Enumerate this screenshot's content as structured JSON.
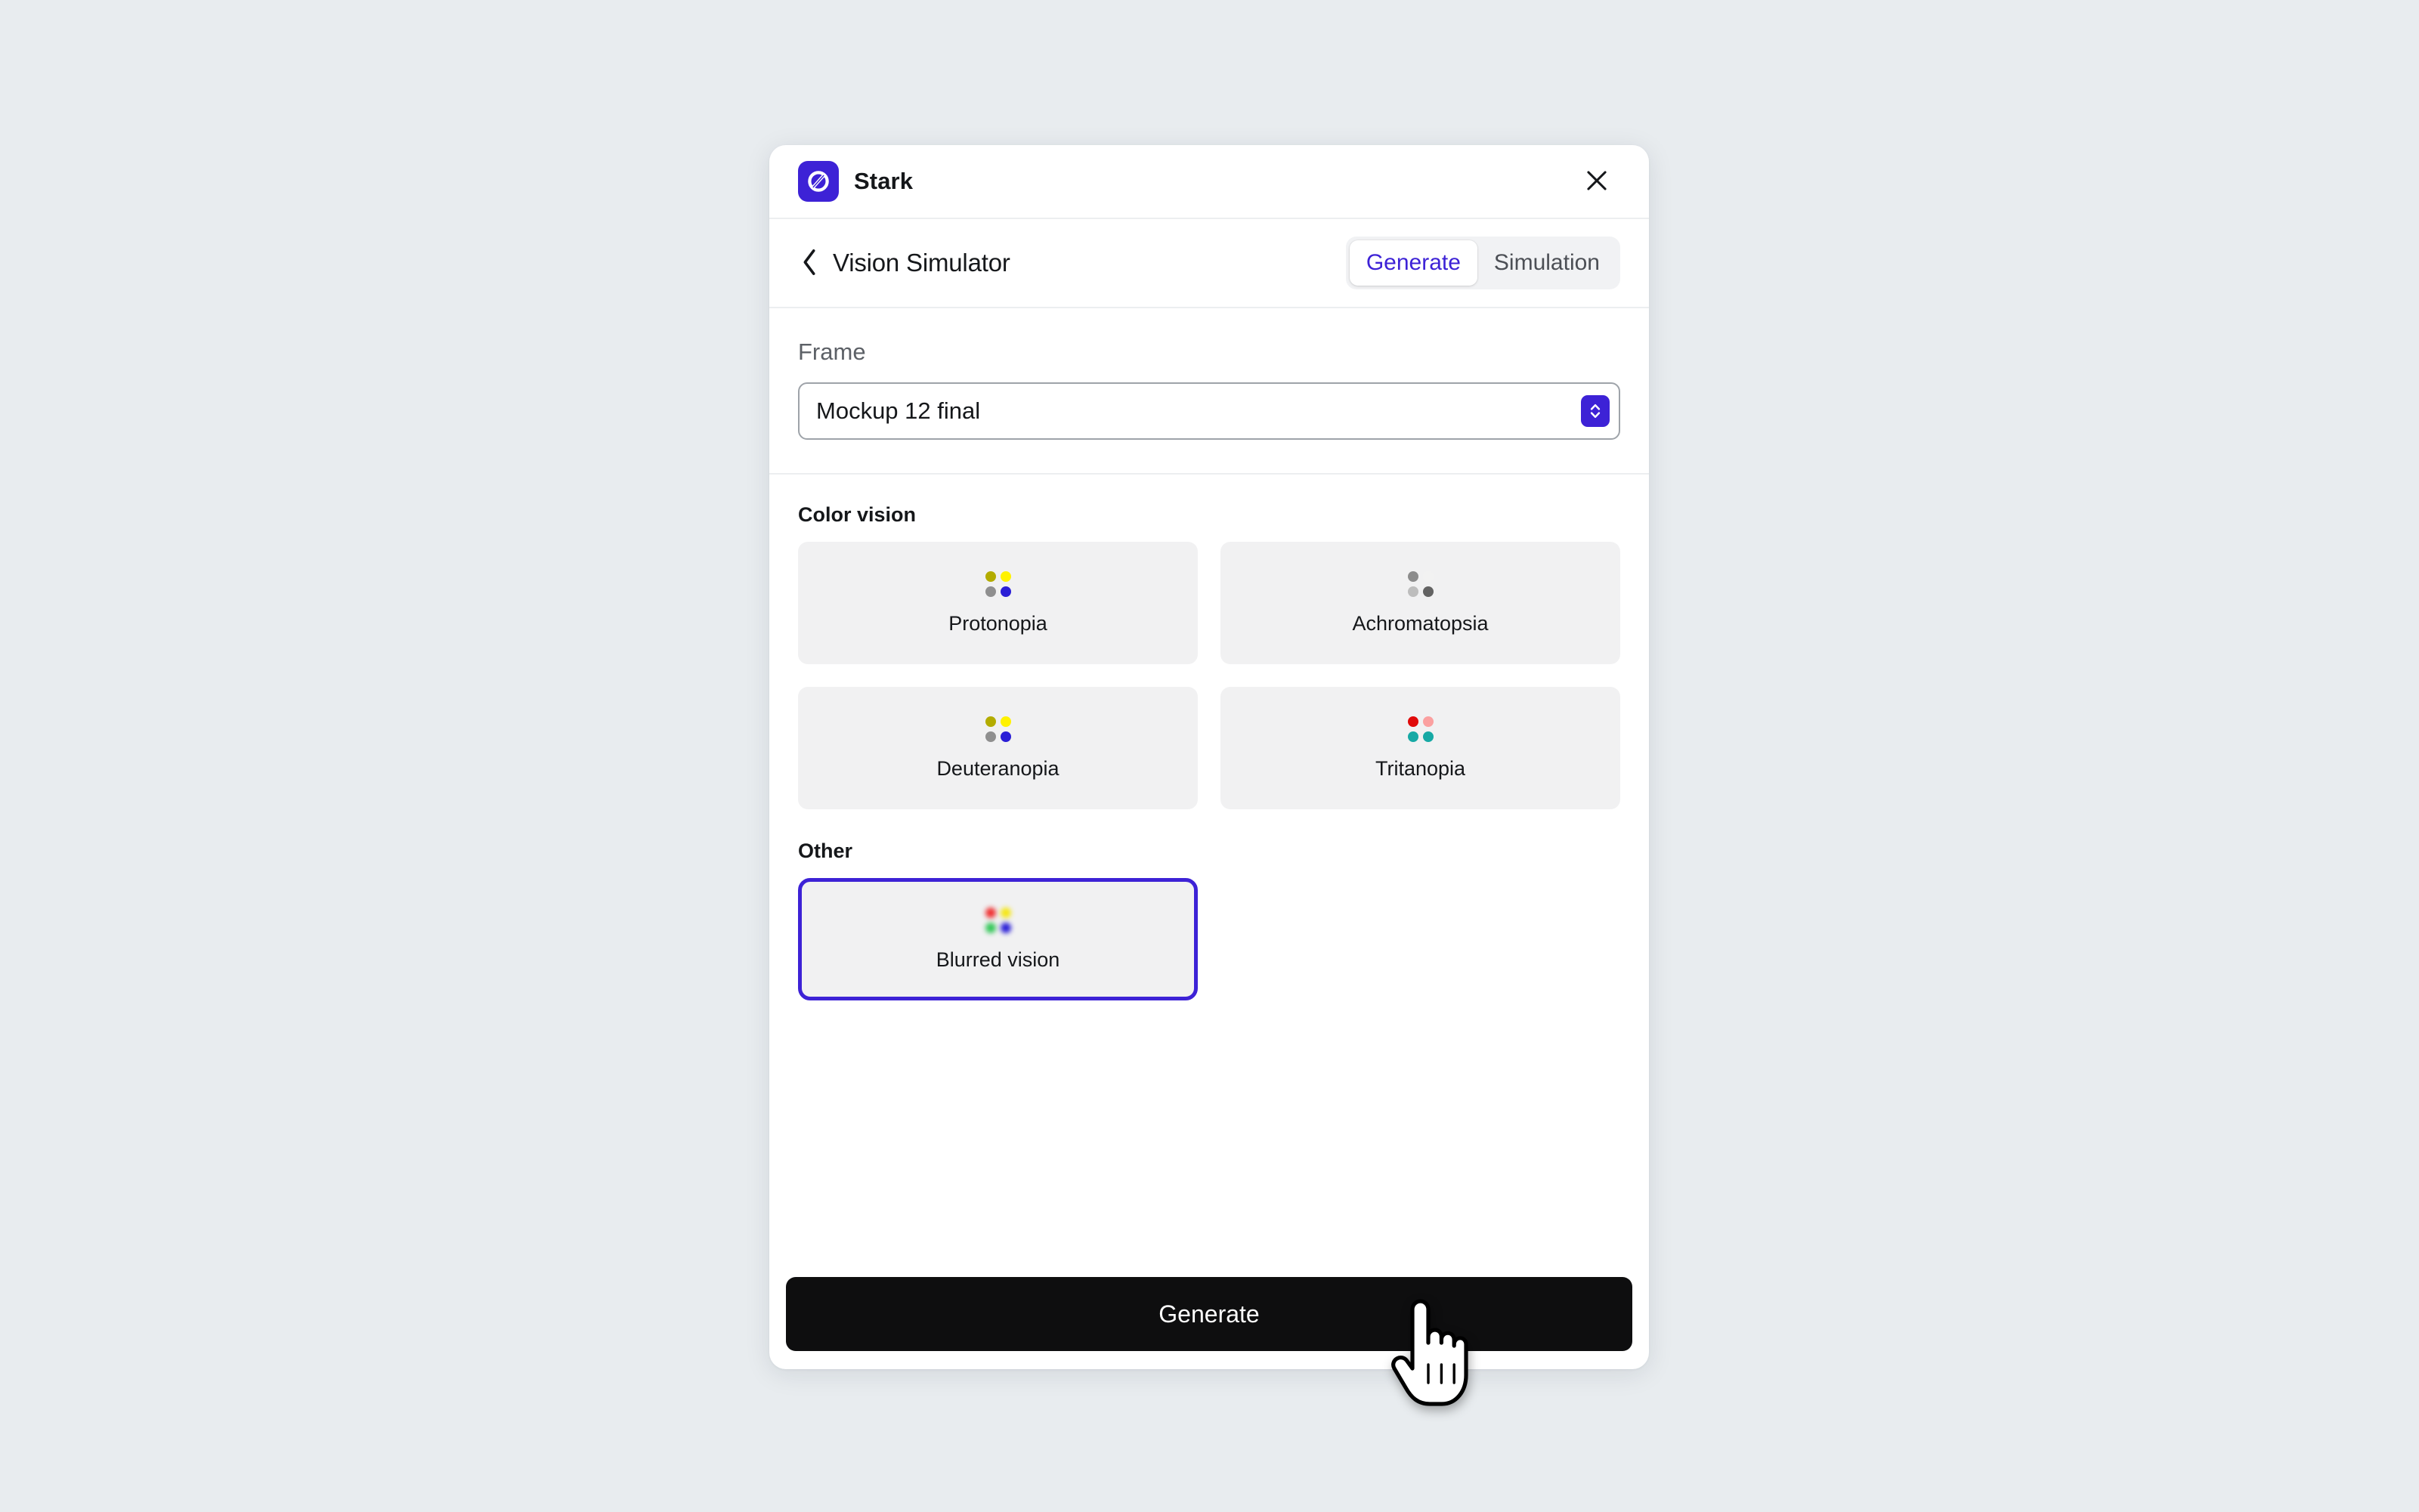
{
  "app": {
    "name": "Stark",
    "logo_icon": "stark-logo-icon",
    "close_icon": "close-icon"
  },
  "subheader": {
    "back_icon": "chevron-left-icon",
    "title": "Vision Simulator",
    "tabs": [
      {
        "label": "Generate",
        "active": true
      },
      {
        "label": "Simulation",
        "active": false
      }
    ]
  },
  "frame": {
    "label": "Frame",
    "selected_value": "Mockup 12 final",
    "stepper_icon": "chevron-up-down-icon"
  },
  "groups": [
    {
      "label": "Color vision",
      "options": [
        {
          "label": "Protonopia",
          "selected": false,
          "dots": [
            "#b3ac00",
            "#fff200",
            "#8f8f8f",
            "#2a1ed6"
          ]
        },
        {
          "label": "Achromatopsia",
          "selected": false,
          "dots": [
            "#8c8c8c",
            "#f2f2f2",
            "#bdbdbd",
            "#636363"
          ]
        },
        {
          "label": "Deuteranopia",
          "selected": false,
          "dots": [
            "#b3ac00",
            "#fff200",
            "#8f8f8f",
            "#2a1ed6"
          ]
        },
        {
          "label": "Tritanopia",
          "selected": false,
          "dots": [
            "#e00a0a",
            "#fba0a0",
            "#17a9a5",
            "#17a9a5"
          ]
        }
      ]
    },
    {
      "label": "Other",
      "options": [
        {
          "label": "Blurred vision",
          "selected": true,
          "blurred": true,
          "dots": [
            "#ef3030",
            "#f5e614",
            "#34c759",
            "#2a1ed6"
          ]
        }
      ]
    }
  ],
  "footer": {
    "generate_label": "Generate"
  },
  "colors": {
    "brand_purple": "#3d22d6",
    "page_background": "#e8ecef",
    "panel_background": "#ffffff",
    "card_background": "#f1f1f2",
    "primary_button": "#0e0e0f"
  },
  "cursor": {
    "icon": "pointing-hand-cursor"
  }
}
